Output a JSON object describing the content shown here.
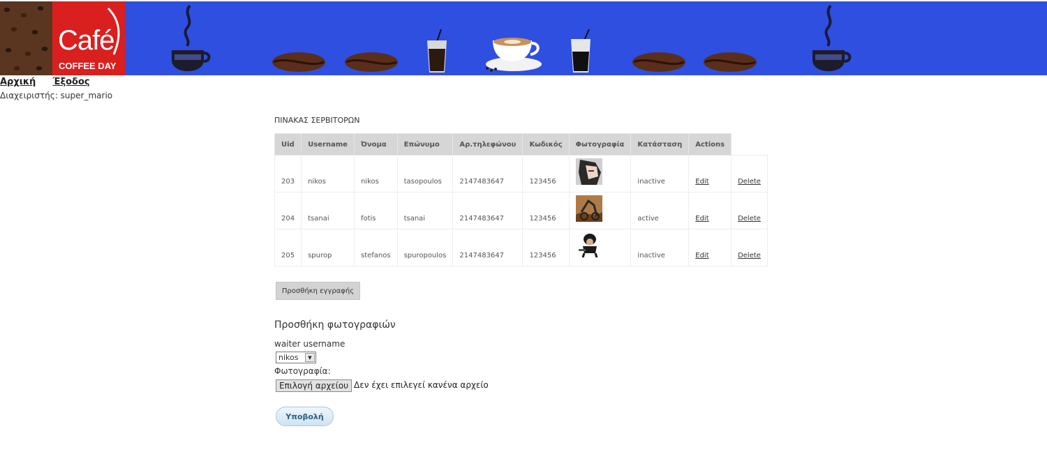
{
  "header": {
    "logo_word": "Café",
    "logo_sub": "COFFEE DAY"
  },
  "nav": {
    "home": "Αρχική",
    "logout": "Έξοδος",
    "admin_label": "Διαχειριστής: super_mario"
  },
  "table": {
    "title": "ΠΙΝΑΚΑΣ ΣΕΡΒΙΤΟΡΩΝ",
    "columns": [
      "Uid",
      "Username",
      "Όνομα",
      "Επώνυμο",
      "Αρ.τηλεφώνου",
      "Κωδικός",
      "Φωτογραφία",
      "Κατάσταση",
      "Actions"
    ],
    "rows": [
      {
        "uid": "203",
        "username": "nikos",
        "first": "nikos",
        "last": "tasopoulos",
        "phone": "2147483647",
        "code": "123456",
        "status": "inactive",
        "edit": "Edit",
        "delete": "Delete"
      },
      {
        "uid": "204",
        "username": "tsanai",
        "first": "fotis",
        "last": "tsanai",
        "phone": "2147483647",
        "code": "123456",
        "status": "active",
        "edit": "Edit",
        "delete": "Delete"
      },
      {
        "uid": "205",
        "username": "spurop",
        "first": "stefanos",
        "last": "spuropoulos",
        "phone": "2147483647",
        "code": "123456",
        "status": "inactive",
        "edit": "Edit",
        "delete": "Delete"
      }
    ],
    "add_button": "Προσθήκη εγγραφής"
  },
  "upload": {
    "title": "Προσθήκη φωτογραφιών",
    "waiter_label": "waiter username",
    "selected_waiter": "nikos",
    "photo_label": "Φωτογραφία:",
    "choose_file": "Επιλογή αρχείου",
    "no_file": "Δεν έχει επιλεγεί κανένα αρχείο",
    "submit": "Υποβολή"
  },
  "colors": {
    "banner": "#2f4fe0",
    "logo_red": "#d9201f",
    "header_gray": "#d6d6d6"
  }
}
